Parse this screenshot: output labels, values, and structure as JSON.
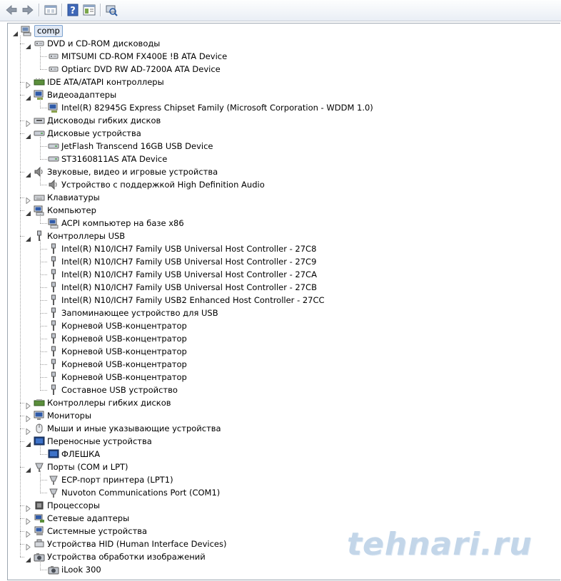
{
  "toolbar": {
    "buttons": [
      "back-icon",
      "forward-icon",
      "up-level-icon",
      "help-icon",
      "properties-icon",
      "scan-hardware-icon"
    ]
  },
  "tree": {
    "root": "comp",
    "categories": [
      {
        "label": "DVD и CD-ROM дисководы",
        "icon": "cdrom-icon",
        "expanded": true,
        "children": [
          {
            "label": "MITSUMI CD-ROM FX400E !B ATA Device",
            "icon": "cdrom-icon"
          },
          {
            "label": "Optiarc DVD RW AD-7200A ATA Device",
            "icon": "cdrom-icon"
          }
        ]
      },
      {
        "label": "IDE ATA/ATAPI контроллеры",
        "icon": "ide-controller-icon",
        "expanded": false,
        "children": []
      },
      {
        "label": "Видеоадаптеры",
        "icon": "display-adapter-icon",
        "expanded": true,
        "children": [
          {
            "label": "Intel(R) 82945G Express Chipset Family (Microsoft Corporation - WDDM 1.0)",
            "icon": "display-adapter-icon"
          }
        ]
      },
      {
        "label": "Дисководы гибких дисков",
        "icon": "floppy-drive-icon",
        "expanded": false,
        "children": []
      },
      {
        "label": "Дисковые устройства",
        "icon": "disk-drive-icon",
        "expanded": true,
        "children": [
          {
            "label": "JetFlash Transcend 16GB USB Device",
            "icon": "disk-drive-icon"
          },
          {
            "label": "ST3160811AS ATA Device",
            "icon": "disk-drive-icon"
          }
        ]
      },
      {
        "label": "Звуковые, видео и игровые устройства",
        "icon": "speaker-icon",
        "expanded": true,
        "children": [
          {
            "label": "Устройство с поддержкой High Definition Audio",
            "icon": "speaker-icon"
          }
        ]
      },
      {
        "label": "Клавиатуры",
        "icon": "keyboard-icon",
        "expanded": false,
        "children": []
      },
      {
        "label": "Компьютер",
        "icon": "computer-icon",
        "expanded": true,
        "children": [
          {
            "label": "ACPI компьютер на базе x86",
            "icon": "computer-icon"
          }
        ]
      },
      {
        "label": "Контроллеры USB",
        "icon": "usb-icon",
        "expanded": true,
        "children": [
          {
            "label": "Intel(R) N10/ICH7 Family USB Universal Host Controller - 27C8",
            "icon": "usb-icon"
          },
          {
            "label": "Intel(R) N10/ICH7 Family USB Universal Host Controller - 27C9",
            "icon": "usb-icon"
          },
          {
            "label": "Intel(R) N10/ICH7 Family USB Universal Host Controller - 27CA",
            "icon": "usb-icon"
          },
          {
            "label": "Intel(R) N10/ICH7 Family USB Universal Host Controller - 27CB",
            "icon": "usb-icon"
          },
          {
            "label": "Intel(R) N10/ICH7 Family USB2 Enhanced Host Controller - 27CC",
            "icon": "usb-icon"
          },
          {
            "label": "Запоминающее устройство для USB",
            "icon": "usb-icon"
          },
          {
            "label": "Корневой USB-концентратор",
            "icon": "usb-icon"
          },
          {
            "label": "Корневой USB-концентратор",
            "icon": "usb-icon"
          },
          {
            "label": "Корневой USB-концентратор",
            "icon": "usb-icon"
          },
          {
            "label": "Корневой USB-концентратор",
            "icon": "usb-icon"
          },
          {
            "label": "Корневой USB-концентратор",
            "icon": "usb-icon"
          },
          {
            "label": "Составное USB устройство",
            "icon": "usb-icon"
          }
        ]
      },
      {
        "label": "Контроллеры гибких дисков",
        "icon": "floppy-controller-icon",
        "expanded": false,
        "children": []
      },
      {
        "label": "Мониторы",
        "icon": "monitor-icon",
        "expanded": false,
        "children": []
      },
      {
        "label": "Мыши и иные указывающие устройства",
        "icon": "mouse-icon",
        "expanded": false,
        "children": []
      },
      {
        "label": "Переносные устройства",
        "icon": "portable-device-icon",
        "expanded": true,
        "children": [
          {
            "label": "ФЛЕШКА",
            "icon": "portable-device-icon"
          }
        ]
      },
      {
        "label": "Порты (COM и LPT)",
        "icon": "port-icon",
        "expanded": true,
        "children": [
          {
            "label": "ECP-порт принтера (LPT1)",
            "icon": "port-icon"
          },
          {
            "label": "Nuvoton Communications Port (COM1)",
            "icon": "port-icon"
          }
        ]
      },
      {
        "label": "Процессоры",
        "icon": "processor-icon",
        "expanded": false,
        "children": []
      },
      {
        "label": "Сетевые адаптеры",
        "icon": "network-adapter-icon",
        "expanded": false,
        "children": []
      },
      {
        "label": "Системные устройства",
        "icon": "system-device-icon",
        "expanded": false,
        "children": []
      },
      {
        "label": "Устройства HID (Human Interface Devices)",
        "icon": "hid-icon",
        "expanded": false,
        "children": []
      },
      {
        "label": "Устройства обработки изображений",
        "icon": "camera-icon",
        "expanded": true,
        "children": [
          {
            "label": "iLook 300",
            "icon": "camera-icon"
          }
        ]
      }
    ]
  },
  "watermark": "tehnari.ru"
}
